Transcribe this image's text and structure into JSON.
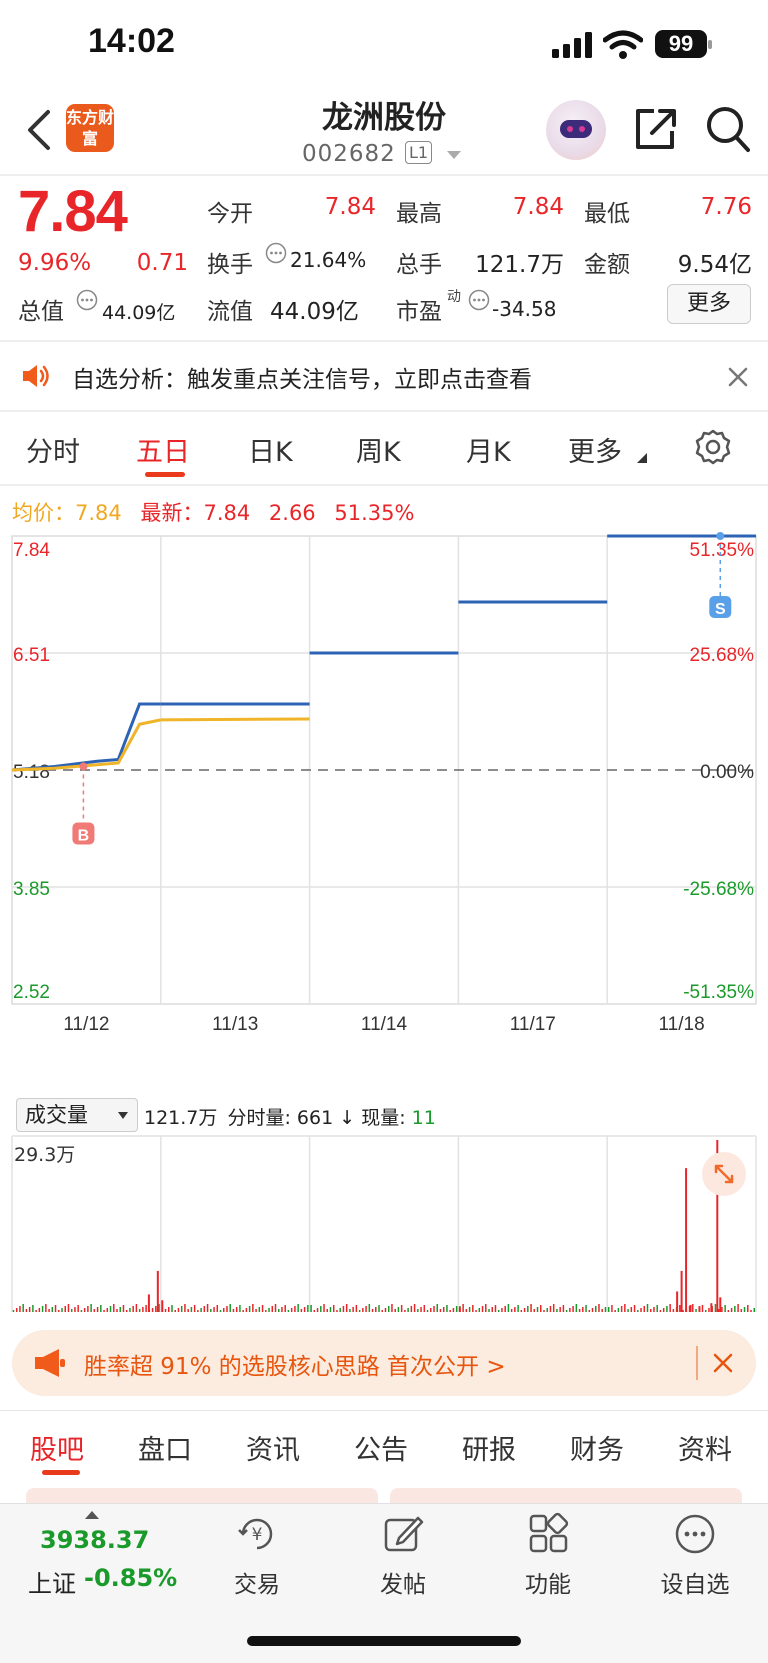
{
  "status_bar": {
    "time": "14:02",
    "battery": "99"
  },
  "header": {
    "logo_text": "东方财富",
    "stock_name": "龙洲股份",
    "stock_code": "002682",
    "level_badge": "L1"
  },
  "quote": {
    "price": "7.84",
    "change_pct": "9.96%",
    "change": "0.71",
    "open_label": "今开",
    "open": "7.84",
    "high_label": "最高",
    "high": "7.84",
    "low_label": "最低",
    "low": "7.76",
    "turnover_label": "换手",
    "turnover": "21.64%",
    "volume_label": "总手",
    "volume": "121.7万",
    "amount_label": "金额",
    "amount": "9.54亿",
    "mktcap_label": "总值",
    "mktcap": "44.09亿",
    "float_label": "流值",
    "float_cap": "44.09亿",
    "pe_label": "市盈",
    "pe_sup": "动",
    "pe": "-34.58",
    "more_label": "更多"
  },
  "notice": {
    "text": "自选分析：触发重点关注信号，立即点击查看"
  },
  "chart_tabs": [
    "分时",
    "五日",
    "日K",
    "周K",
    "月K",
    "更多"
  ],
  "active_chart_tab": "五日",
  "avg_line": {
    "avg_label": "均价：",
    "avg": "7.84",
    "latest_label": "最新：",
    "latest": "7.84",
    "change": "2.66",
    "change_pct": "51.35%"
  },
  "chart_data": {
    "type": "line",
    "dates": [
      "11/12",
      "11/13",
      "11/14",
      "11/17",
      "11/18"
    ],
    "y_left_ticks": [
      "7.84",
      "6.51",
      "5.18",
      "3.85",
      "2.52"
    ],
    "y_right_ticks": [
      "51.35%",
      "25.68%",
      "0.00%",
      "-25.68%",
      "-51.35%"
    ],
    "ylim": [
      2.52,
      7.84
    ],
    "base_price": 5.18,
    "series": [
      {
        "name": "最新",
        "color": "#2d63b4",
        "day_values": [
          [
            5.18,
            5.2,
            5.22,
            5.25,
            5.28,
            5.3,
            5.93,
            5.93
          ],
          [
            5.93,
            5.93
          ],
          [
            6.51,
            6.51
          ],
          [
            7.09,
            7.09
          ],
          [
            7.84,
            7.84
          ]
        ]
      },
      {
        "name": "均价",
        "color": "#f0b428",
        "day_values": [
          [
            5.18,
            5.19,
            5.2,
            5.22,
            5.24,
            5.26,
            5.7,
            5.75
          ],
          [
            5.75,
            5.76
          ]
        ]
      }
    ],
    "markers": [
      {
        "label": "B",
        "day": 0,
        "frac": 0.48,
        "price": 5.22,
        "color": "#f07a76"
      },
      {
        "label": "S",
        "day": 4,
        "frac": 0.76,
        "price": 7.84,
        "color": "#5aa0e8"
      }
    ],
    "grid": true
  },
  "volume": {
    "select_label": "成交量",
    "total": "121.7万",
    "minute_label": "分时量:",
    "minute_value": "661",
    "now_label": "现量:",
    "now_value": "11",
    "max_label": "29.3万",
    "max": 293000,
    "spikes": [
      {
        "day": 0,
        "frac": 0.98,
        "value": 70000
      },
      {
        "day": 0,
        "frac": 0.92,
        "value": 30000
      },
      {
        "day": 1,
        "frac": 0.01,
        "value": 20000
      },
      {
        "day": 3,
        "frac": 0.01,
        "value": 8000
      },
      {
        "day": 4,
        "frac": 0.47,
        "value": 35000
      },
      {
        "day": 4,
        "frac": 0.5,
        "value": 70000
      },
      {
        "day": 4,
        "frac": 0.53,
        "value": 245000
      },
      {
        "day": 4,
        "frac": 0.56,
        "value": 12000
      },
      {
        "day": 4,
        "frac": 0.62,
        "value": 10000
      },
      {
        "day": 4,
        "frac": 0.7,
        "value": 15000
      },
      {
        "day": 4,
        "frac": 0.74,
        "value": 293000
      },
      {
        "day": 4,
        "frac": 0.76,
        "value": 25000
      }
    ]
  },
  "banner": {
    "text": "胜率超 91% 的选股核心思路 首次公开 >"
  },
  "bottom_tabs": [
    "股吧",
    "盘口",
    "资讯",
    "公告",
    "研报",
    "财务",
    "资料"
  ],
  "bottom_nav": {
    "index_value": "3938.37",
    "index_name": "上证",
    "index_change": "-0.85%",
    "items": [
      "交易",
      "发帖",
      "功能",
      "设自选"
    ]
  }
}
